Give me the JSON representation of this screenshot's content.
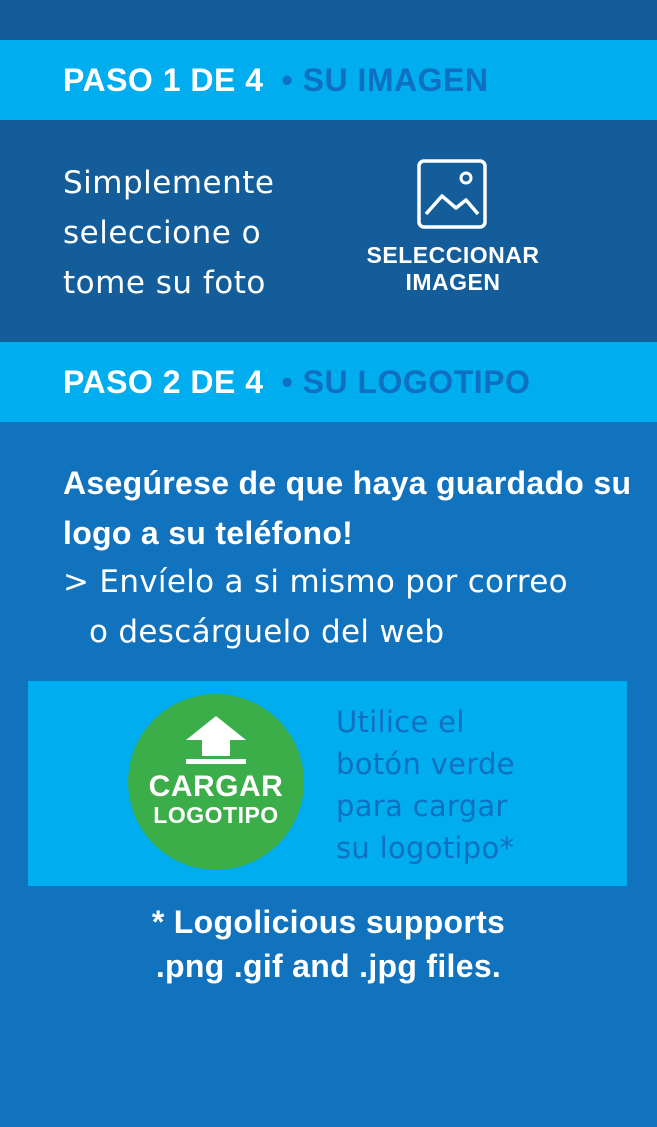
{
  "step1": {
    "step_label": "PASO 1 DE 4",
    "title": "• SU IMAGEN",
    "description": [
      "Simplemente",
      "seleccione o",
      "tome su foto"
    ],
    "select_button": {
      "icon": "image-icon",
      "label_line1": "SELECCIONAR",
      "label_line2": "IMAGEN"
    }
  },
  "step2": {
    "step_label": "PASO 2 DE 4",
    "title": "• SU LOGOTIPO",
    "notice_bold": "Asegúrese de que haya guardado su logo a su teléfono!",
    "notice_line1": "> Envíelo a si mismo por correo",
    "notice_line2": "o descárguelo del web",
    "upload_button": {
      "icon": "upload-arrow-icon",
      "label_line1": "CARGAR",
      "label_line2": "LOGOTIPO"
    },
    "upload_help": [
      "Utilice el",
      "botón verde",
      "para cargar",
      "su logotipo*"
    ]
  },
  "footnote": {
    "line1": "* Logolicious supports",
    "line2": ".png .gif and .jpg files."
  },
  "colors": {
    "background": "#1172bd",
    "panel_dark": "#135d9b",
    "header_cyan": "#00aeef",
    "title_blue": "#0f6fc0",
    "upload_green": "#3bae49"
  }
}
